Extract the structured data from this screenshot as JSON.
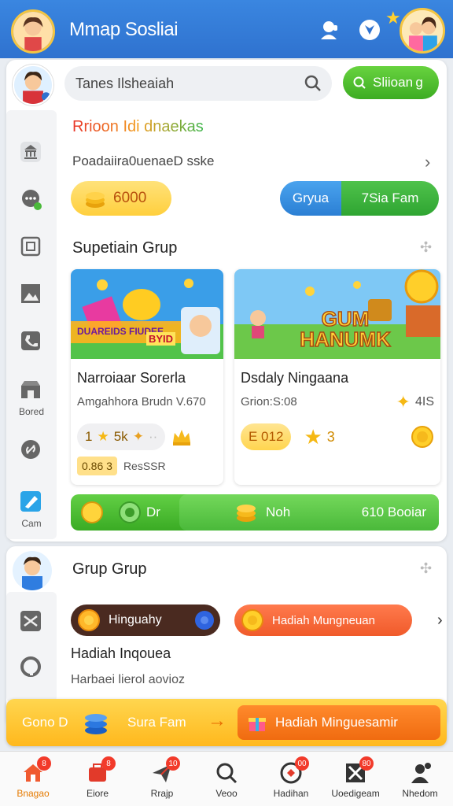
{
  "header": {
    "title": "Mmap Sosliai",
    "icons": [
      "support-icon",
      "compass-icon"
    ]
  },
  "search": {
    "placeholder": "Tanes Ilsheaiah"
  },
  "action_pill": {
    "label": "Sliioan g"
  },
  "promo": {
    "headline": "Rrioon Idi dnaekas",
    "subline": "Poadaiira0uenaeD sske",
    "coins": "6000",
    "split_left": "Gryua",
    "split_right": "7Sia Fam"
  },
  "section1": {
    "title": "Supetiain Grup"
  },
  "games": [
    {
      "title": "Narroiaar Sorerla",
      "subtitle": "Amgahhora Brudn V.670",
      "image_text": "DUAREIDS FIUDEE",
      "image_badge": "BYID",
      "rating_left": "1",
      "rating_mid": "5k",
      "tag": "0.86 3",
      "tag_label": "ResSSR"
    },
    {
      "title": "Dsdaly Ningaana",
      "subtitle": "Grion:S:08",
      "image_text": "GUM HANUMK",
      "score": "4IS",
      "price": "E 012",
      "stars": "3"
    }
  ],
  "green_bar": {
    "left": "Dr",
    "mid": "Noh",
    "right": "610 Booiar"
  },
  "section2": {
    "title": "Grup Grup",
    "pill_dark": "Hinguahy",
    "pill_orange": "Hadiah Mungneuan",
    "item_title": "Hadiah Inqouea",
    "item_sub": "Harbaei lierol aovioz"
  },
  "sidebar": {
    "labels": [
      "Bored",
      "Cam"
    ]
  },
  "banner": {
    "left": "Gono D",
    "mid": "Sura Fam",
    "button": "Hadiah Minguesamir"
  },
  "bottom_nav": [
    {
      "label": "Bnagao",
      "badge": "8",
      "icon": "home-icon",
      "active": true
    },
    {
      "label": "Eiore",
      "badge": "8",
      "icon": "store-icon"
    },
    {
      "label": "Rrajp",
      "badge": "10",
      "icon": "send-icon"
    },
    {
      "label": "Veoo",
      "badge": "",
      "icon": "search-icon"
    },
    {
      "label": "Hadihan",
      "badge": "00",
      "icon": "gift-icon"
    },
    {
      "label": "Uoedigeam",
      "badge": "80",
      "icon": "game-icon"
    },
    {
      "label": "Nhedom",
      "badge": "",
      "icon": "profile-icon"
    }
  ],
  "colors": {
    "header": "#2f72cf",
    "accent_green": "#3cac22",
    "accent_orange": "#f06b10",
    "accent_yellow": "#ffcf3d"
  }
}
